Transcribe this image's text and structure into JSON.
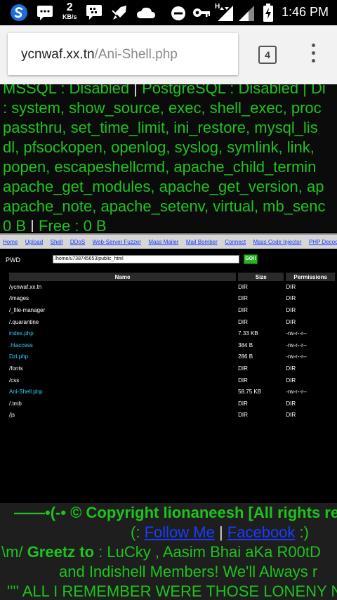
{
  "status_bar": {
    "speed_value": "2",
    "speed_unit": "KB/s",
    "time": "1:46 PM",
    "signal_type": "H"
  },
  "browser": {
    "url_host": "ycnwaf.xx.tn",
    "url_path": "/Ani-Shell.php",
    "tab_count": "4"
  },
  "info": {
    "line1_a": "MSSQL : Disabled",
    "line1_sep": "|",
    "line1_b": "PostgreSQL : Disabled",
    "line1_c": "| Di",
    "line2": ": system, show_source, exec, shell_exec, proc",
    "line3": "passthru, set_time_limit, ini_restore, mysql_lis",
    "line4": "dl, pfsockopen, openlog, syslog, symlink, link,",
    "line5": "popen, escapeshellcmd, apache_child_termin",
    "line6": "apache_get_modules, apache_get_version, ap",
    "line7": "apache_note, apache_setenv, virtual, mb_senc",
    "line8_a": "0 B",
    "line8_sep": "|",
    "line8_b": "Free : 0 B"
  },
  "nav": [
    "Home",
    "Upload",
    "Shell",
    "DDoS",
    "Web-Server Fuzzer",
    "Mass Mailer",
    "Mail Bomber",
    "Connect",
    "Mass Code Injector",
    "PHP Decoder"
  ],
  "pwd": {
    "label": "PWD",
    "value": "/home/u738745653/public_html",
    "go_label": "GO!!"
  },
  "table": {
    "headers": [
      "Name",
      "Size",
      "Permissions"
    ],
    "rows": [
      {
        "name": "/ycnwaf.xx.tn",
        "size": "DIR",
        "perm": "DIR",
        "kind": "dir"
      },
      {
        "name": "/images",
        "size": "DIR",
        "perm": "DIR",
        "kind": "dir"
      },
      {
        "name": "/_file-manager",
        "size": "DIR",
        "perm": "DIR",
        "kind": "dir"
      },
      {
        "name": "/.quarantine",
        "size": "DIR",
        "perm": "DIR",
        "kind": "dir"
      },
      {
        "name": "index.php",
        "size": "7.33 KB",
        "perm": "-rw-r--r--",
        "kind": "file"
      },
      {
        "name": ".htaccess",
        "size": "384 B",
        "perm": "-rw-r--r--",
        "kind": "file"
      },
      {
        "name": "Dzi.php",
        "size": "286 B",
        "perm": "-rw-r--r--",
        "kind": "file"
      },
      {
        "name": "/fonts",
        "size": "DIR",
        "perm": "DIR",
        "kind": "dir"
      },
      {
        "name": "/css",
        "size": "DIR",
        "perm": "DIR",
        "kind": "dir"
      },
      {
        "name": "Ani-Shell.php",
        "size": "58.75 KB",
        "perm": "-rw-r--r--",
        "kind": "file"
      },
      {
        "name": "/.tmb",
        "size": "DIR",
        "perm": "DIR",
        "kind": "dir"
      },
      {
        "name": "/js",
        "size": "DIR",
        "perm": "DIR",
        "kind": "dir"
      }
    ]
  },
  "footer": {
    "copyright": "——•(-• © Copyright lionaneesh [All rights re",
    "follow_prefix": "(:",
    "follow_me": "Follow Me",
    "follow_sep": "|",
    "facebook": "Facebook",
    "follow_suffix": ":)",
    "greetz_prefix": "\\m/",
    "greetz_label": "Greetz to",
    "greetz_text": ": LuCky , Aasim Bhai aKa R00tD",
    "greetz_line2": "and Indishell Members! We'll Always r",
    "quote": "'''' ALL I REMEMBER WERE THOSE LONENY N"
  },
  "colors": {
    "green_text": "#1cc41c",
    "link_blue": "#1a3cff",
    "file_cyan": "#2fd2ff"
  }
}
